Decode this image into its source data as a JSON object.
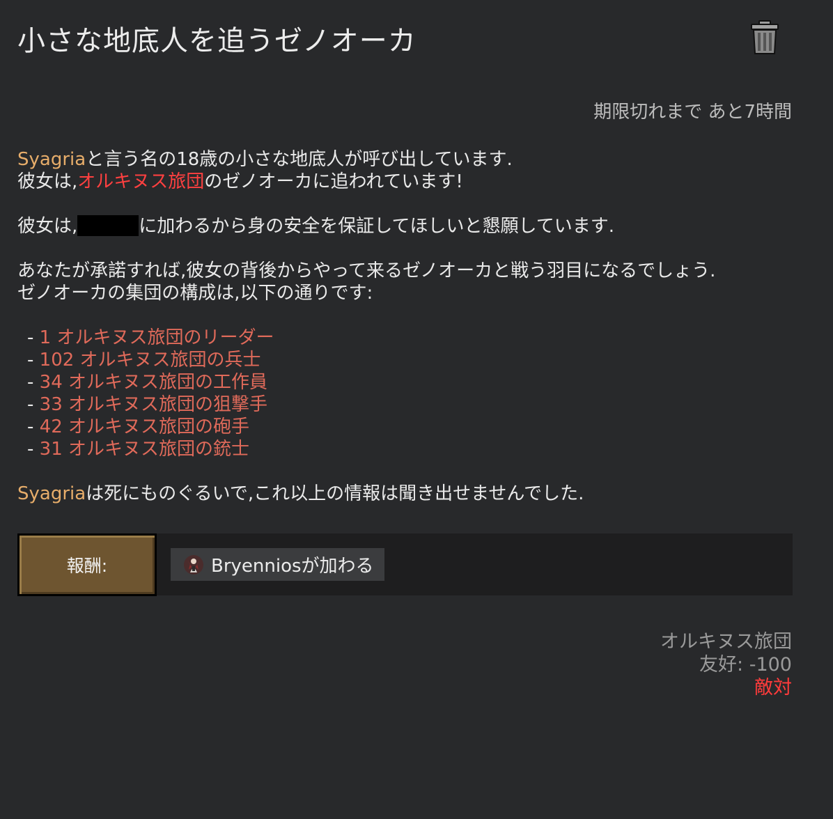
{
  "title": "小さな地底人を追うゼノオーカ",
  "expiry": "期限切れまで あと7時間",
  "pawn_name": "Syagria",
  "faction_name": "オルキヌス旅団",
  "line1_rest": "と言う名の18歳の小さな地底人が呼び出しています.",
  "line2_prefix": "彼女は,",
  "line2_suffix": "のゼノオーカに追われています!",
  "line3_prefix": "彼女は,",
  "line3_suffix": "に加わるから身の安全を保証してほしいと懇願しています.",
  "line4": "あなたが承諾すれば,彼女の背後からやって来るゼノオーカと戦う羽目になるでしょう.",
  "line5": "ゼノオーカの集団の構成は,以下の通りです:",
  "enemies": [
    {
      "bullet": "- ",
      "text": "1 オルキヌス旅団のリーダー"
    },
    {
      "bullet": "- ",
      "text": "102 オルキヌス旅団の兵士"
    },
    {
      "bullet": "- ",
      "text": "34 オルキヌス旅団の工作員"
    },
    {
      "bullet": "- ",
      "text": "33 オルキヌス旅団の狙撃手"
    },
    {
      "bullet": "- ",
      "text": "42 オルキヌス旅団の砲手"
    },
    {
      "bullet": "- ",
      "text": "31 オルキヌス旅団の銃士"
    }
  ],
  "closing_suffix": "は死にものぐるいで,これ以上の情報は聞き出せませんでした.",
  "reward": {
    "label": "報酬:",
    "item": "Bryenniosが加わる",
    "item_icon": "pawn-portrait-icon"
  },
  "faction_info": {
    "name": "オルキヌス旅団",
    "goodwill": "友好: -100",
    "relation": "敵対"
  },
  "colors": {
    "background": "#28292b",
    "pawn_name": "#e7ad6a",
    "faction_hostile": "#ff4040",
    "enemy_list": "#e06a5a",
    "reward_button": "#6e5530"
  }
}
